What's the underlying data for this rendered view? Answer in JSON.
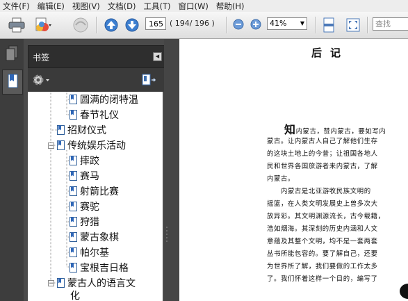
{
  "menu": [
    "文件(F)",
    "编辑(E)",
    "视图(V)",
    "文档(D)",
    "工具(T)",
    "窗口(W)",
    "帮助(H)"
  ],
  "toolbar": {
    "page_current": "165",
    "page_count": "( 194/ 196 )",
    "zoom": "41%",
    "search_placeholder": "查找"
  },
  "panel": {
    "title": "书签"
  },
  "bookmarks": [
    {
      "label": "圆满的闭特温",
      "level": 3
    },
    {
      "label": "春节礼仪",
      "level": 3
    },
    {
      "label": "招财仪式",
      "level": 2
    },
    {
      "label": "传统娱乐活动",
      "level": 2,
      "expanded": true
    },
    {
      "label": "摔跤",
      "level": 3
    },
    {
      "label": "赛马",
      "level": 3
    },
    {
      "label": "射箭比赛",
      "level": 3
    },
    {
      "label": "赛驼",
      "level": 3
    },
    {
      "label": "狩猎",
      "level": 3
    },
    {
      "label": "蒙古象棋",
      "level": 3
    },
    {
      "label": "帕尔基",
      "level": 3
    },
    {
      "label": "宝根吉日格",
      "level": 3
    },
    {
      "label": "蒙古人的语言文",
      "level": 2,
      "expanded": true
    },
    {
      "label": "化",
      "level": 2,
      "continuation": true
    }
  ],
  "document": {
    "title": "后记",
    "dropcap": "知",
    "lines": [
      "内蒙古，赞内蒙古，要如写内",
      "蒙古。让内蒙古人自己了解他们生存",
      "的这块土地上的今昔；让祖国各地人",
      "民和世界各国旅游者来内蒙古，了解",
      "内蒙古。",
      "内蒙古是北亚游牧民族文明的",
      "摇篮，在人类文明发展史上曾多次大",
      "放异彩。其文明渊源流长，古今载籍，",
      "浩如烟海。其深刻的历史内涵和人文",
      "意蕴及其整个文明，均不是一套两套",
      "丛书所能包容的。要了解自己，还要",
      "为世界所了解，我们要做的工作太多",
      "了。我们怀着这样一个目的，编写了"
    ]
  }
}
